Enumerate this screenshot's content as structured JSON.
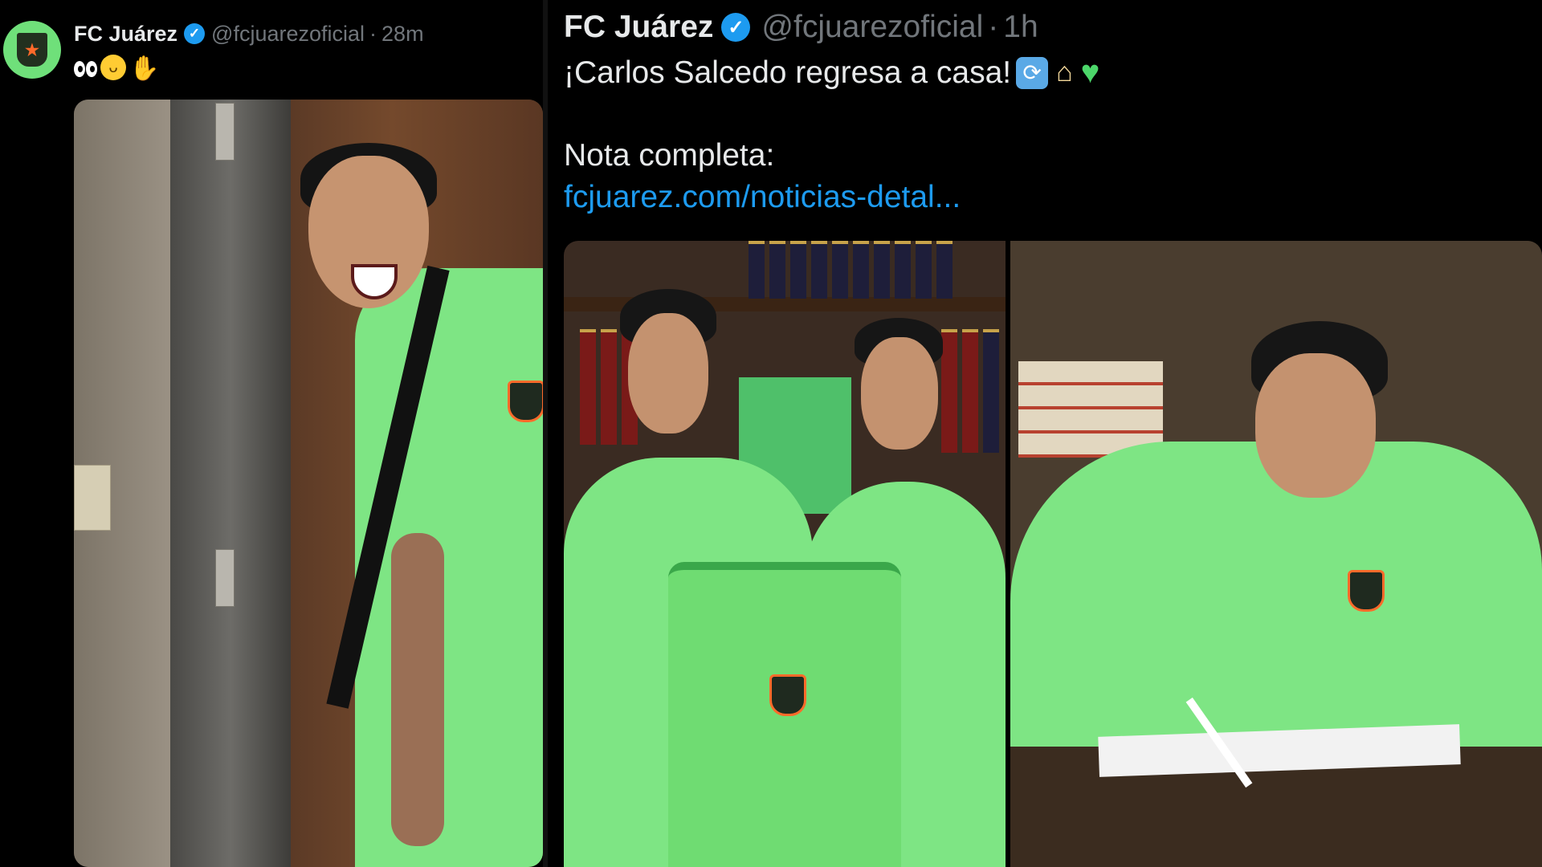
{
  "left_tweet": {
    "account_name": "FC Juárez",
    "handle": "@fcjuarezoficial",
    "separator": "·",
    "time": "28m",
    "emojis": [
      "eyes-emoji",
      "grinning-face-emoji",
      "waving-hand-emoji"
    ],
    "photo": "player-peeking-through-door"
  },
  "right_tweet": {
    "account_name": "FC Juárez",
    "handle": "@fcjuarezoficial",
    "separator": "·",
    "time": "1h",
    "text_line1": "¡Carlos Salcedo regresa a casa!",
    "line1_emojis": [
      "repeat-arrows-emoji",
      "house-emoji",
      "green-heart-emoji"
    ],
    "text_line2": "Nota completa:",
    "link_text": "fcjuarez.com/noticias-detal...",
    "photos": [
      "player-holding-jersey-with-official",
      "player-signing-contract"
    ]
  },
  "colors": {
    "background": "#000000",
    "text_primary": "#e7e9ea",
    "text_secondary": "#71767b",
    "link": "#1d9bf0",
    "verified_badge": "#1d9bf0",
    "jersey_green": "#7ee584"
  }
}
